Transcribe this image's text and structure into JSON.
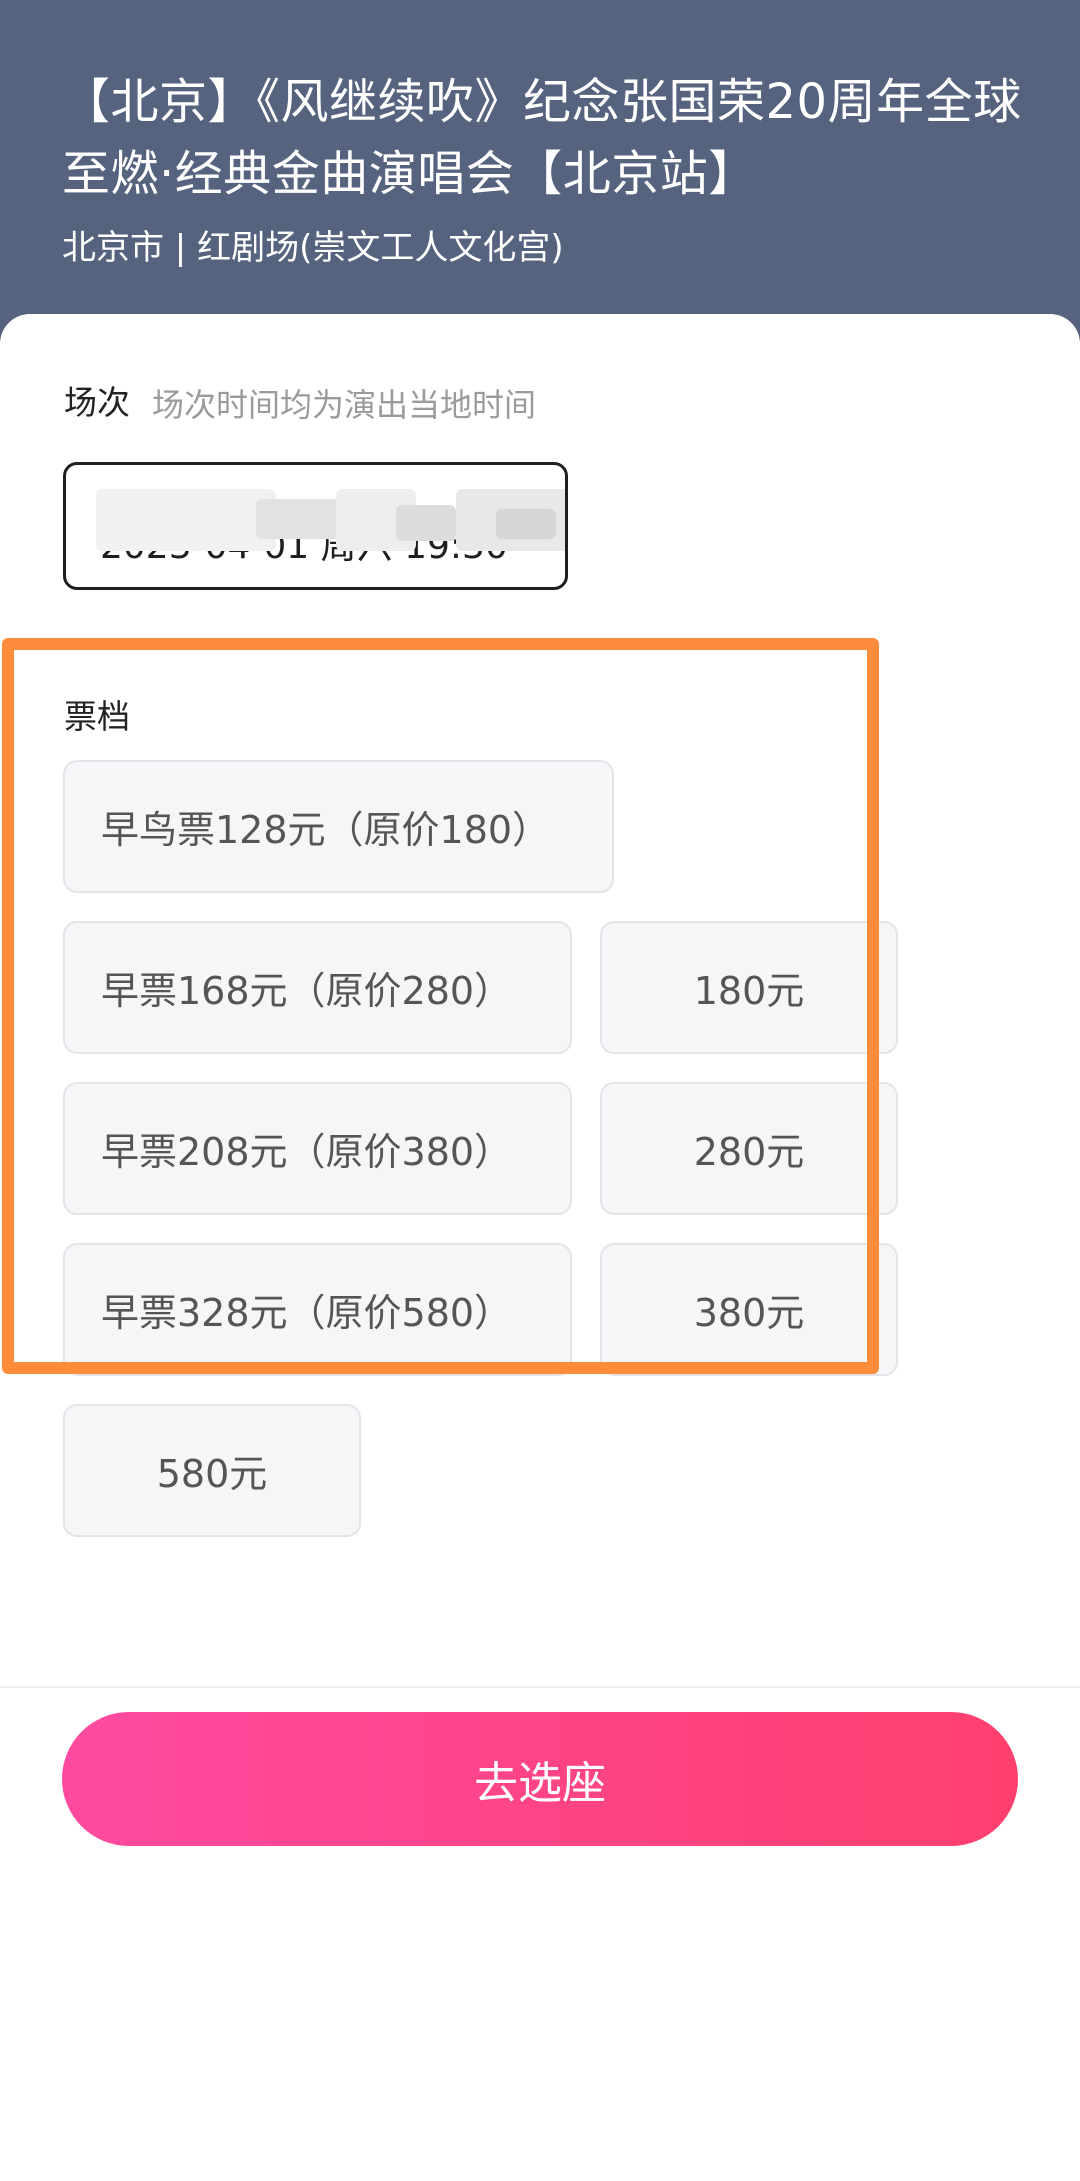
{
  "header": {
    "title": "【北京】《风继续吹》纪念张国荣20周年全球至燃·经典金曲演唱会【北京站】",
    "venue": "北京市 | 红剧场(崇文工人文化宫)"
  },
  "session": {
    "label": "场次",
    "hint": "场次时间均为演出当地时间",
    "selected_value": "2023-04-01 周六 19:30"
  },
  "tiers": {
    "label": "票档",
    "options": [
      {
        "label": "早鸟票128元（原价180）"
      },
      {
        "label": "早票168元（原价280）"
      },
      {
        "label": "180元"
      },
      {
        "label": "早票208元（原价380）"
      },
      {
        "label": "280元"
      },
      {
        "label": "早票328元（原价580）"
      },
      {
        "label": "380元"
      },
      {
        "label": "580元"
      }
    ]
  },
  "footer": {
    "cta_label": "去选座"
  },
  "colors": {
    "header_bg": "#55637f",
    "highlight_border": "#ff8c3a",
    "cta_gradient_start": "#ff4aa0",
    "cta_gradient_end": "#ff406e"
  }
}
